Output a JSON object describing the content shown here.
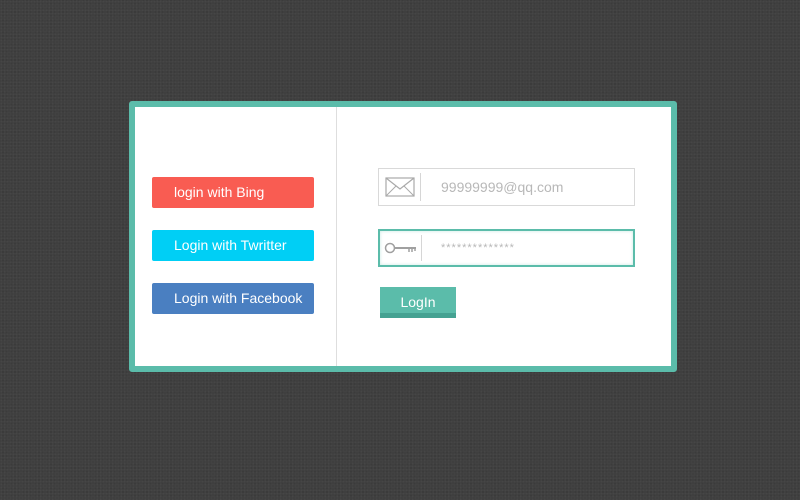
{
  "colors": {
    "background": "#3f3f3f",
    "card_border": "#5bbcaa",
    "bing": "#f95c52",
    "twitter": "#00cff5",
    "facebook": "#4a7fc1",
    "accent": "#5bbcaa"
  },
  "social": {
    "bing_label": "login with Bing",
    "twitter_label": "Login with Twritter",
    "facebook_label": "Login with Facebook"
  },
  "form": {
    "email": {
      "icon": "envelope-icon",
      "value": "99999999@qq.com"
    },
    "password": {
      "icon": "key-icon",
      "value": "**************"
    },
    "login_label": "LogIn"
  }
}
